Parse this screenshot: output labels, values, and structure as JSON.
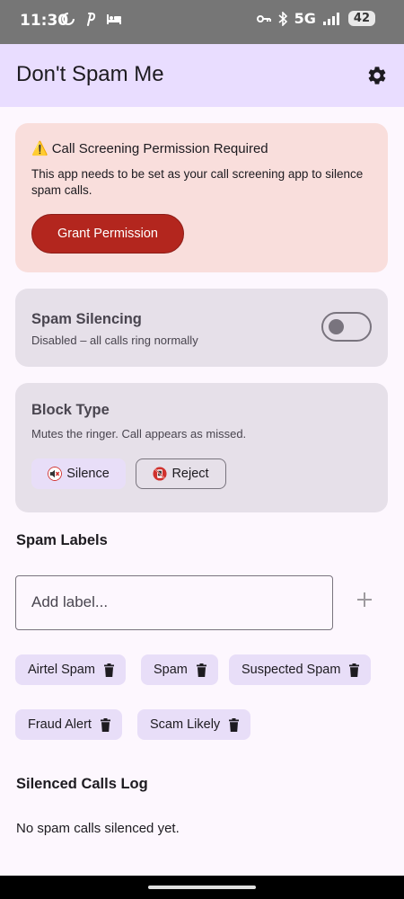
{
  "status_bar": {
    "time": "11:30",
    "network": "5G",
    "battery": "42",
    "icons": [
      "loading-icon",
      "pinterest-icon",
      "bed-icon",
      "key-icon",
      "bluetooth-icon",
      "signal-icon",
      "battery-icon"
    ]
  },
  "app_bar": {
    "title": "Don't Spam Me",
    "settings_icon": "gear-icon"
  },
  "permission_card": {
    "warning_icon": "⚠️",
    "title": "Call Screening Permission Required",
    "text": "This app needs to be set as your call screening app to silence spam calls.",
    "button_label": "Grant Permission",
    "colors": {
      "background": "#f9dedc",
      "button": "#b3261e"
    }
  },
  "silencing_card": {
    "title": "Spam Silencing",
    "subtitle": "Disabled – all calls ring normally",
    "enabled": false
  },
  "block_type_card": {
    "title": "Block Type",
    "subtitle": "Mutes the ringer. Call appears as missed.",
    "options": [
      {
        "label": "Silence",
        "icon": "muted-speaker-icon",
        "selected": true
      },
      {
        "label": "Reject",
        "icon": "no-phone-icon",
        "selected": false
      }
    ]
  },
  "spam_labels": {
    "heading": "Spam Labels",
    "input_placeholder": "Add label...",
    "input_value": "",
    "add_icon": "plus-icon",
    "labels": [
      "Airtel Spam",
      "Spam",
      "Suspected Spam",
      "Fraud Alert",
      "Scam Likely"
    ]
  },
  "silenced_log": {
    "heading": "Silenced Calls Log",
    "empty_message": "No spam calls silenced yet."
  },
  "colors": {
    "app_bar": "#e9ddff",
    "page_background": "#fdf7fe",
    "card_background": "#e6e0e9",
    "chip_background": "#e8def8"
  }
}
